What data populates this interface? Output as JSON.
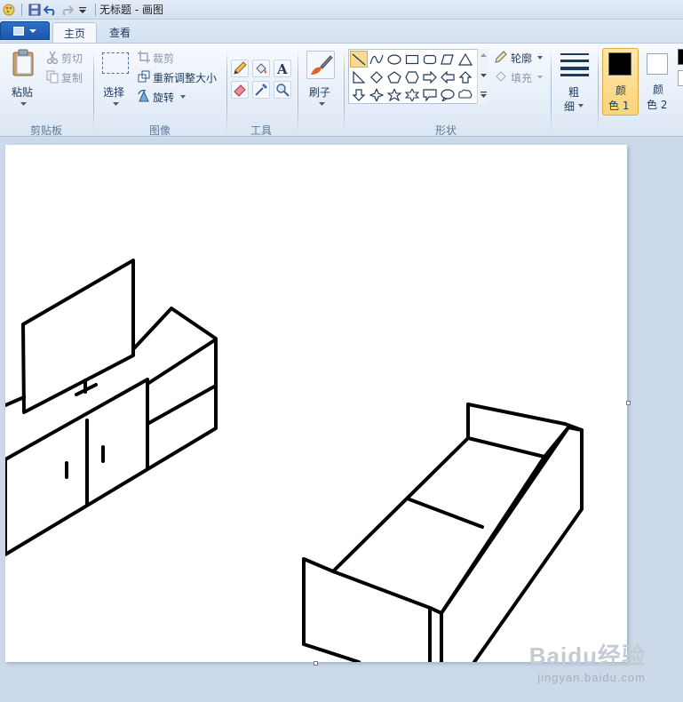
{
  "window": {
    "title": "无标题 - 画图"
  },
  "tabs": [
    {
      "label": "主页"
    },
    {
      "label": "查看"
    }
  ],
  "clipboard": {
    "paste_label": "粘贴",
    "cut_label": "剪切",
    "copy_label": "复制",
    "group_label": "剪贴板"
  },
  "image": {
    "select_label": "选择",
    "crop_label": "裁剪",
    "resize_label": "重新调整大小",
    "rotate_label": "旋转",
    "group_label": "图像"
  },
  "tools": {
    "group_label": "工具",
    "icons": [
      "pencil-icon",
      "fill-icon",
      "text-icon",
      "eraser-icon",
      "color-picker-icon",
      "magnifier-icon"
    ]
  },
  "brushes": {
    "label": "刷子"
  },
  "shapes": {
    "group_label": "形状",
    "outline_label": "轮廓",
    "fill_label": "填充"
  },
  "size": {
    "label_line1": "粗",
    "label_line2": "细"
  },
  "colors": {
    "color1_line1": "颜",
    "color1_line2": "色 1",
    "color2_line1": "颜",
    "color2_line2": "色 2",
    "color1_value": "#000000",
    "color2_value": "#ffffff"
  },
  "watermark": {
    "logo": "Baidu经验",
    "sub": "jingyan.baidu.com"
  }
}
